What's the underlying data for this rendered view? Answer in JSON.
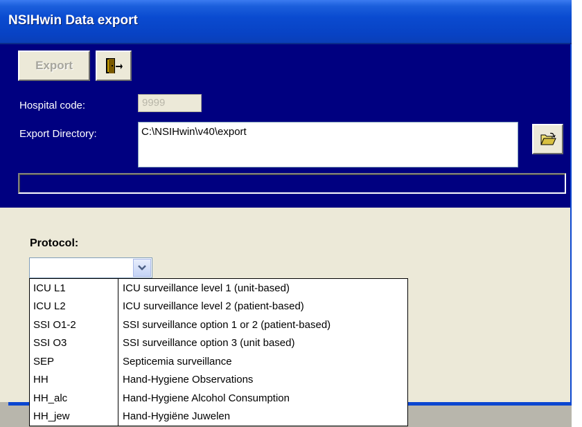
{
  "window": {
    "title": "NSIHwin Data export"
  },
  "toolbar": {
    "export_label": "Export",
    "exit_icon": "door-exit-icon"
  },
  "form": {
    "hospital_code_label": "Hospital code:",
    "hospital_code_value": "9999",
    "export_dir_label": "Export Directory:",
    "export_dir_value": "C:\\NSIHwin\\v40\\export",
    "browse_icon": "open-folder-icon"
  },
  "protocol": {
    "label": "Protocol:",
    "selected": "",
    "options": [
      {
        "code": "ICU L1",
        "desc": "ICU surveillance level 1 (unit-based)"
      },
      {
        "code": "ICU L2",
        "desc": "ICU surveillance level 2 (patient-based)"
      },
      {
        "code": "SSI O1-2",
        "desc": "SSI surveillance option 1 or 2 (patient-based)"
      },
      {
        "code": "SSI O3",
        "desc": "SSI surveillance option 3 (unit based)"
      },
      {
        "code": "SEP",
        "desc": "Septicemia surveillance"
      },
      {
        "code": "HH",
        "desc": "Hand-Hygiene Observations"
      },
      {
        "code": "HH_alc",
        "desc": "Hand-Hygiene Alcohol Consumption"
      },
      {
        "code": "HH_jew",
        "desc": "Hand-Hygiëne Juwelen"
      }
    ]
  },
  "colors": {
    "header_bg": "#000080",
    "titlebar": "#0842c4",
    "window_bg": "#ece9d8"
  }
}
